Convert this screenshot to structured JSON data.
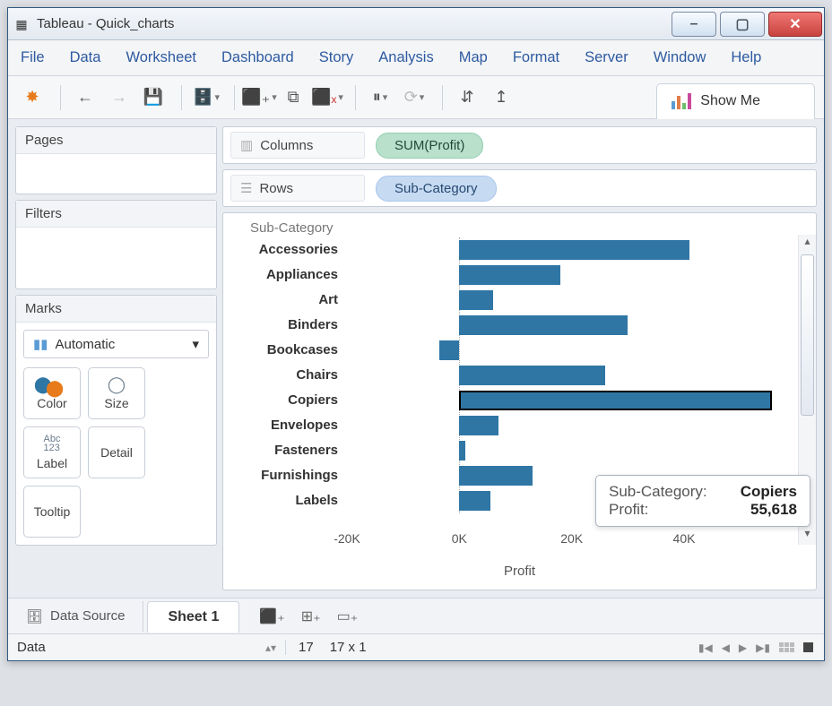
{
  "window": {
    "title": "Tableau - Quick_charts"
  },
  "menu": [
    "File",
    "Data",
    "Worksheet",
    "Dashboard",
    "Story",
    "Analysis",
    "Map",
    "Format",
    "Server",
    "Window",
    "Help"
  ],
  "toolbar": {
    "show_me": "Show Me"
  },
  "sidecards": {
    "pages_title": "Pages",
    "filters_title": "Filters",
    "marks_title": "Marks",
    "marks_type": "Automatic",
    "props": {
      "color": "Color",
      "size": "Size",
      "label": "Label",
      "detail": "Detail",
      "tooltip": "Tooltip"
    }
  },
  "shelves": {
    "columns_label": "Columns",
    "rows_label": "Rows",
    "columns_pill": "SUM(Profit)",
    "rows_pill": "Sub-Category"
  },
  "viz": {
    "header": "Sub-Category",
    "axis_title": "Profit",
    "x_ticks": [
      "-20K",
      "0K",
      "20K",
      "40K"
    ]
  },
  "tooltip": {
    "l1_label": "Sub-Category:",
    "l1_value": "Copiers",
    "l2_label": "Profit:",
    "l2_value": "55,618"
  },
  "tabs": {
    "data_source": "Data Source",
    "sheet": "Sheet 1"
  },
  "status": {
    "left": "Data",
    "marks": "17",
    "dims": "17 x 1"
  },
  "chart_data": {
    "type": "bar",
    "title": "Sub-Category",
    "xlabel": "Profit",
    "ylabel": "",
    "xlim": [
      -20000,
      55000
    ],
    "categories": [
      "Accessories",
      "Appliances",
      "Art",
      "Binders",
      "Bookcases",
      "Chairs",
      "Copiers",
      "Envelopes",
      "Fasteners",
      "Furnishings",
      "Labels"
    ],
    "values": [
      41000,
      18000,
      6000,
      30000,
      -3500,
      26000,
      55618,
      7000,
      1000,
      13000,
      5500
    ],
    "highlight_index": 6,
    "x_ticks": [
      -20000,
      0,
      20000,
      40000
    ]
  }
}
